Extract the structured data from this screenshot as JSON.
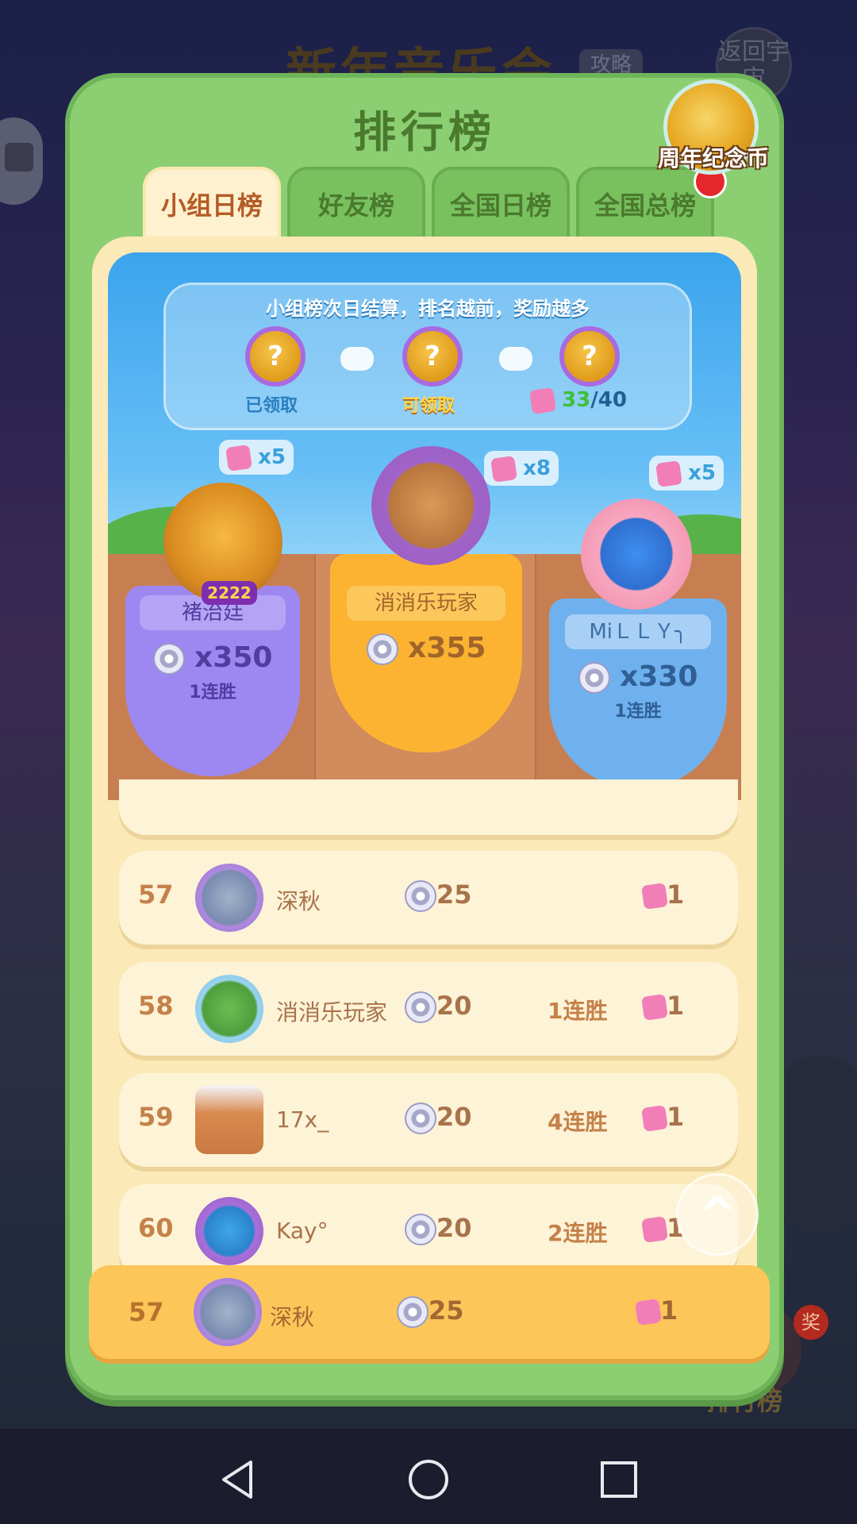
{
  "background": {
    "game_title": "新年音乐会",
    "game_tag": "攻略",
    "back_button": "返回宇宙",
    "rank_badge": "奖",
    "rank_text": "排行榜"
  },
  "modal": {
    "title": "排行榜",
    "close_icon": "✖",
    "tabs": [
      {
        "label": "小组日榜",
        "active": true
      },
      {
        "label": "好友榜",
        "active": false
      },
      {
        "label": "全国日榜",
        "active": false
      },
      {
        "label": "全国总榜",
        "active": false
      }
    ],
    "coin_badge_label": "周年纪念币"
  },
  "notice": {
    "text": "小组榜次日结算，排名越前，奖励越多",
    "chests": [
      {
        "label": "已领取",
        "status": "claimed"
      },
      {
        "label": "可领取",
        "status": "claimable"
      },
      {
        "label": "",
        "status": "locked"
      }
    ],
    "progress_current": "33",
    "progress_total": "/40"
  },
  "podium": {
    "first": {
      "name": "消消乐玩家",
      "score": "x355",
      "reward": "x8",
      "streak": ""
    },
    "second": {
      "name": "褚治廷",
      "score": "x350",
      "reward": "x5",
      "streak": "1连胜",
      "level_badge": "2222"
    },
    "third": {
      "name": "MiＬＬＹ╮",
      "score": "x330",
      "reward": "x5",
      "streak": "1连胜"
    }
  },
  "rows": [
    {
      "rank": "57",
      "name": "深秋",
      "score": "25",
      "streak": "",
      "reward": "1"
    },
    {
      "rank": "58",
      "name": "消消乐玩家",
      "score": "20",
      "streak": "1连胜",
      "reward": "1"
    },
    {
      "rank": "59",
      "name": "17x_",
      "score": "20",
      "streak": "4连胜",
      "reward": "1"
    },
    {
      "rank": "60",
      "name": "Kay°",
      "score": "20",
      "streak": "2连胜",
      "reward": "1"
    }
  ],
  "my_row": {
    "rank": "57",
    "name": "深秋",
    "score": "25",
    "reward": "1"
  },
  "colors": {
    "modal_green": "#8ccf73",
    "tab_active_text": "#b45b26",
    "row_bg": "#fdf3d6",
    "my_row_bg": "#fcc659",
    "first_place": "#fcb332",
    "second_place": "#9d87f0",
    "third_place": "#6fb1ee"
  },
  "icons": {
    "close": "close-icon",
    "disc": "cd-disc-icon",
    "fragment": "puzzle-fragment-icon",
    "scroll_top": "chevron-up-icon",
    "nav": [
      "back-triangle-icon",
      "home-circle-icon",
      "recents-square-icon"
    ]
  }
}
